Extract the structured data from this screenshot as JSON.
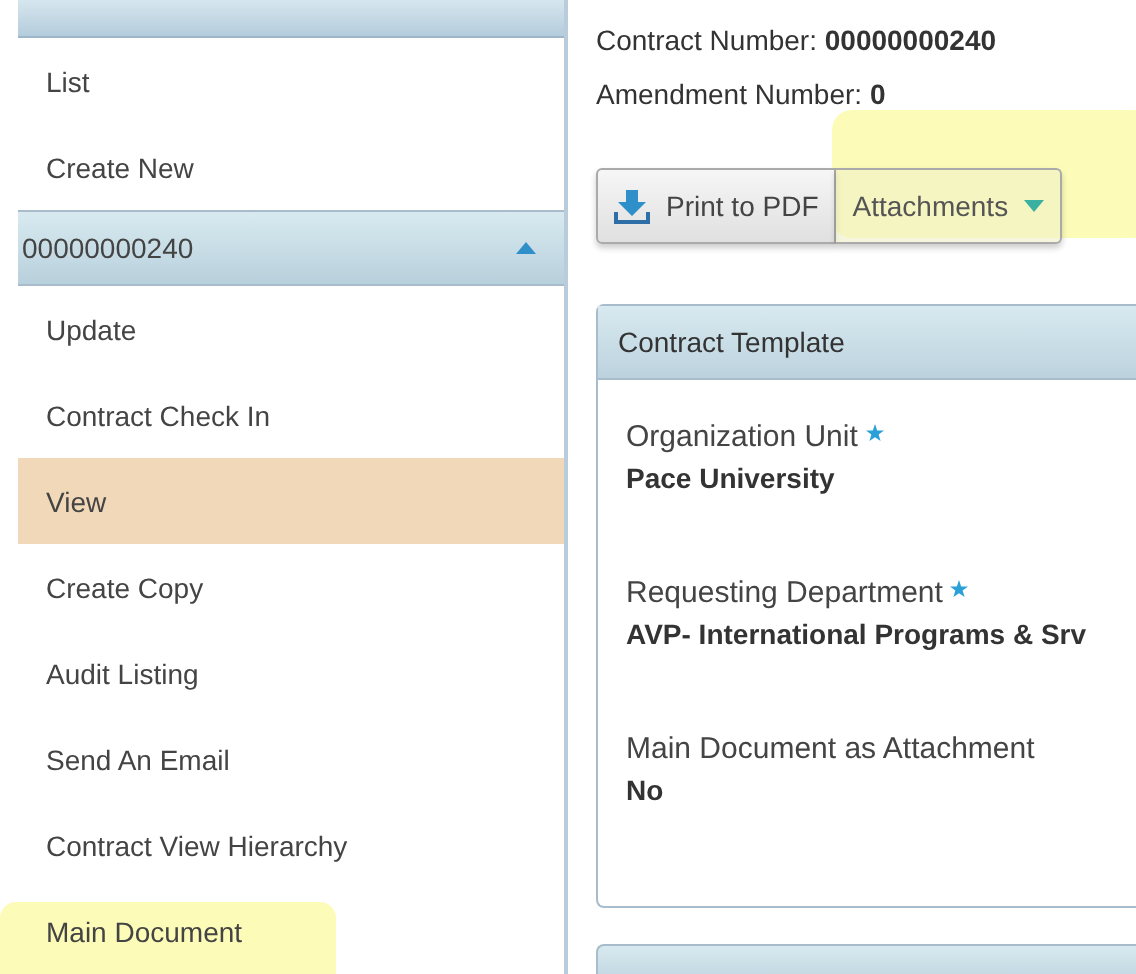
{
  "sidebar": {
    "items": [
      {
        "label": "List",
        "kind": "item",
        "selected": false,
        "highlighted": false
      },
      {
        "label": "Create New",
        "kind": "item",
        "selected": false,
        "highlighted": false
      },
      {
        "label": "00000000240",
        "kind": "section",
        "expanded": true
      },
      {
        "label": "Update",
        "kind": "item",
        "selected": false,
        "highlighted": false
      },
      {
        "label": "Contract Check In",
        "kind": "item",
        "selected": false,
        "highlighted": false
      },
      {
        "label": "View",
        "kind": "item",
        "selected": true,
        "highlighted": false
      },
      {
        "label": "Create Copy",
        "kind": "item",
        "selected": false,
        "highlighted": false
      },
      {
        "label": "Audit Listing",
        "kind": "item",
        "selected": false,
        "highlighted": false
      },
      {
        "label": "Send An Email",
        "kind": "item",
        "selected": false,
        "highlighted": false
      },
      {
        "label": "Contract View Hierarchy",
        "kind": "item",
        "selected": false,
        "highlighted": false
      },
      {
        "label": "Main Document",
        "kind": "item",
        "selected": false,
        "highlighted": true
      }
    ]
  },
  "header": {
    "contract_number_label": "Contract Number:",
    "contract_number": "00000000240",
    "amendment_label": "Amendment Number:",
    "amendment": "0"
  },
  "toolbar": {
    "print": {
      "label": "Print to PDF"
    },
    "attachments": {
      "label": "Attachments",
      "highlighted": true
    }
  },
  "panel": {
    "title": "Contract Template",
    "fields": [
      {
        "label": "Organization Unit",
        "required": true,
        "value": "Pace University"
      },
      {
        "label": "Requesting Department",
        "required": true,
        "value": "AVP- International Programs & Srv"
      },
      {
        "label": "Main Document as Attachment",
        "required": false,
        "value": "No"
      }
    ]
  }
}
